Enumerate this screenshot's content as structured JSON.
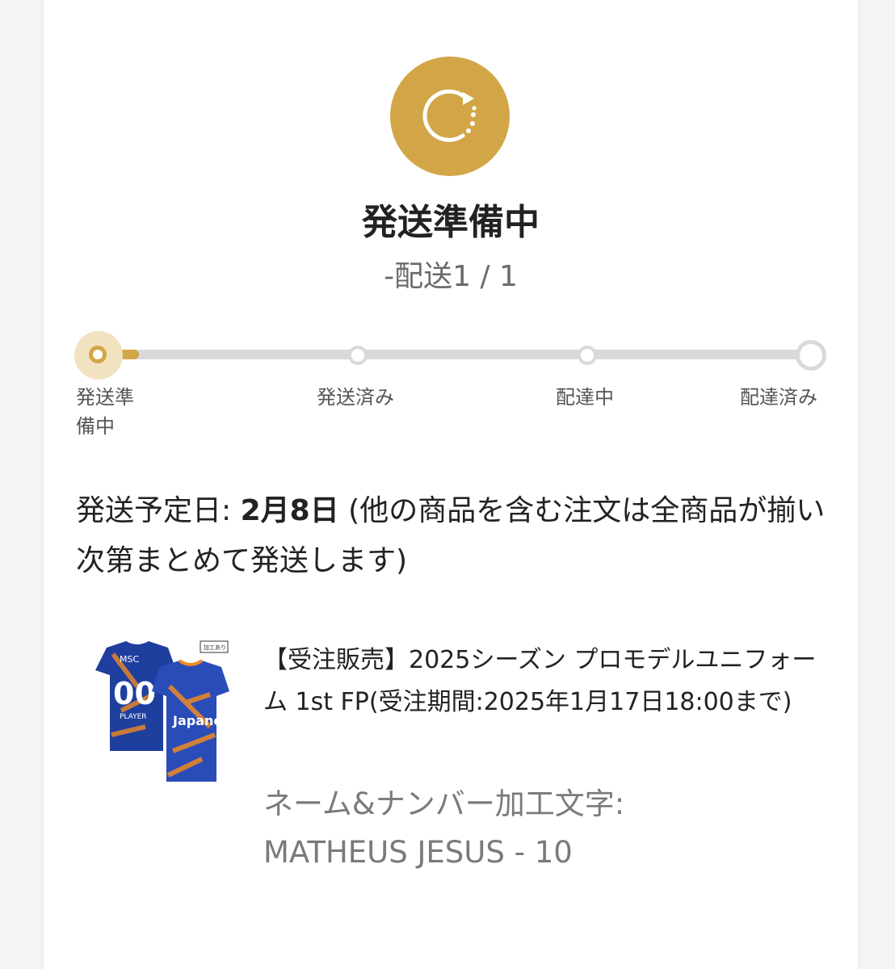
{
  "status": {
    "icon": "refresh-icon",
    "color": "#D2A647",
    "title": "発送準備中",
    "subtitle": "-配送1 / 1"
  },
  "progress": {
    "active_step": 1,
    "steps": [
      {
        "label": "発送準備中"
      },
      {
        "label": "発送済み"
      },
      {
        "label": "配達中"
      },
      {
        "label": "配達済み"
      }
    ]
  },
  "shipping": {
    "label": "発送予定日:",
    "date": "2月8日",
    "note": "(他の商品を含む注文は全商品が揃い次第まとめて発送します)"
  },
  "product": {
    "name": "【受注販売】2025シーズン プロモデルユニフォーム 1st FP(受注期間:2025年1月17日18:00まで)",
    "option_label": "ネーム&ナンバー加工文字:",
    "option_value": "MATHEUS JESUS - 10",
    "image": {
      "tag": "加工あり",
      "club": "MSC",
      "number": "00",
      "player_label": "PLAYER",
      "sponsor": "Japanet",
      "colors": {
        "primary": "#1f3f9e",
        "accent": "#f08a24"
      }
    }
  }
}
